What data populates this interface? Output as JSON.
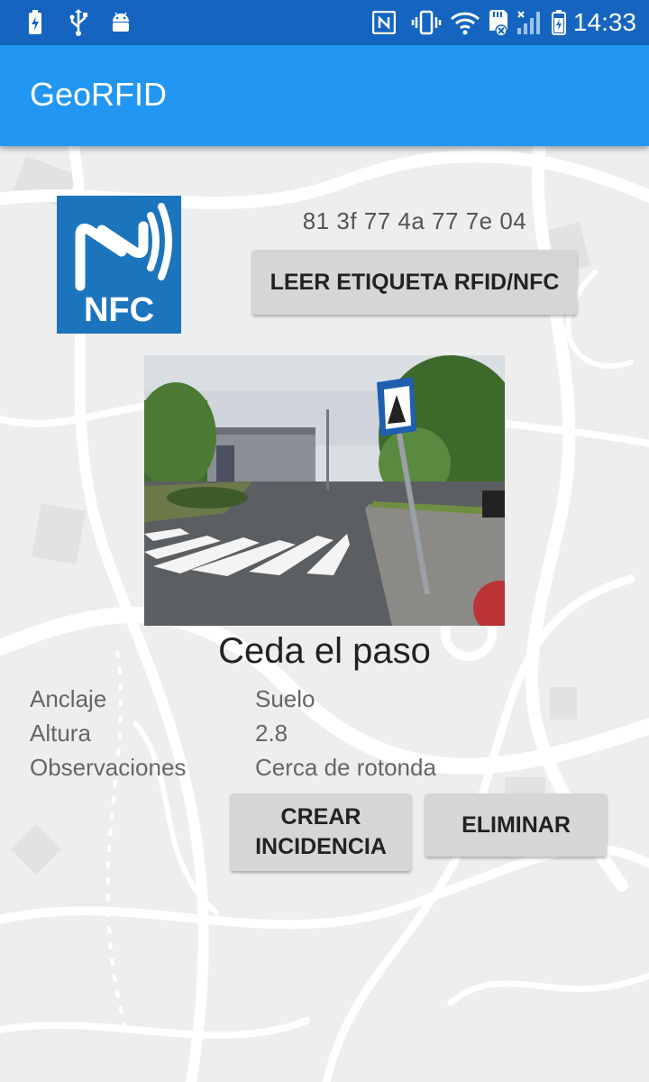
{
  "status_bar": {
    "time": "14:33",
    "icons": [
      "battery-charging-icon",
      "usb-icon",
      "android-icon",
      "nfc-status-icon",
      "vibrate-icon",
      "wifi-icon",
      "sd-card-icon",
      "signal-icon",
      "battery-icon"
    ]
  },
  "app_bar": {
    "title": "GeoRFID"
  },
  "nfc": {
    "logo_text": "NFC",
    "tag_uid": "81 3f 77 4a 77 7e 04",
    "read_button_label": "LEER ETIQUETA RFID/NFC"
  },
  "sign": {
    "name": "Ceda el paso",
    "fields": [
      {
        "label": "Anclaje",
        "value": "Suelo"
      },
      {
        "label": "Altura",
        "value": "2.8"
      },
      {
        "label": "Observaciones",
        "value": "Cerca de rotonda"
      }
    ]
  },
  "actions": {
    "create_label": "CREAR INCIDENCIA",
    "delete_label": "ELIMINAR"
  },
  "colors": {
    "status_bar": "#1565c0",
    "app_bar": "#2196f3",
    "nfc_logo": "#1c75bc",
    "button": "#d6d6d6"
  }
}
